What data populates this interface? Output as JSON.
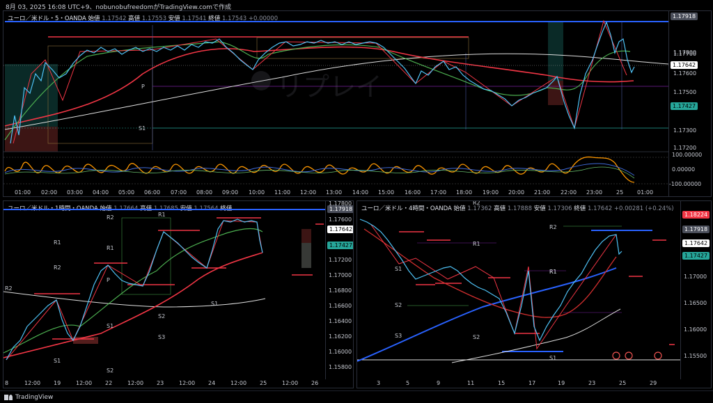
{
  "header": {
    "text": "8月 03, 2025 16:08 UTC+9、nobunobufreedomがTradingView.comで作成"
  },
  "footer": {
    "brand": "TradingView"
  },
  "watermark": "リプレイ",
  "colors": {
    "blue": "#2962ff",
    "red": "#f23645",
    "green": "#4caf50",
    "orange": "#ff9800",
    "white": "#e0e0e0",
    "cyan": "#26c6da",
    "bg": "#000000"
  },
  "top_chart": {
    "title": "ユーロ／米ドル・5・OANDA",
    "ohlc_prefix": "始値",
    "high_label": "高値",
    "low_label": "安値",
    "close_label": "終値",
    "price_ticks": [
      "1.17800",
      "1.17700",
      "1.17600",
      "1.17500",
      "1.17300",
      "1.17200"
    ],
    "price_tags": [
      {
        "value": "1.17918",
        "kind": "grey"
      },
      {
        "value": "1.17642",
        "kind": "white"
      },
      {
        "value": "1.17427",
        "kind": "cyan"
      }
    ],
    "pivot_labels": [
      "P",
      "S1"
    ],
    "osc_ticks": [
      "100.00000",
      "0.00000",
      "-100.00000"
    ],
    "time_ticks": [
      "01:00",
      "02:00",
      "03:00",
      "04:00",
      "05:00",
      "06:00",
      "07:00",
      "08:00",
      "09:00",
      "10:00",
      "11:00",
      "12:00",
      "13:00",
      "14:00",
      "15:00",
      "16:00",
      "17:00",
      "18:00",
      "19:00",
      "20:00",
      "21:00",
      "22:00",
      "23:00",
      "25",
      "01:00"
    ]
  },
  "left_chart": {
    "title": "ユーロ／米ドル・1時間・OANDA",
    "ohlc_prefix": "始値",
    "high_label": "高値",
    "low_label": "安値",
    "close_label": "終値",
    "price_ticks": [
      "1.17800",
      "1.17600",
      "1.17400",
      "1.17200",
      "1.17000",
      "1.16800",
      "1.16600",
      "1.16400",
      "1.16200",
      "1.16000",
      "1.15800"
    ],
    "price_tags": [
      {
        "value": "1.17918",
        "kind": "grey"
      },
      {
        "value": "1.17642",
        "kind": "white"
      },
      {
        "value": "1.17427",
        "kind": "cyan"
      }
    ],
    "pivot_labels": [
      "R2",
      "R1",
      "R2",
      "R1",
      "P",
      "S1",
      "S2",
      "S3",
      "S1",
      "S2",
      "R1",
      "R2",
      "S1"
    ],
    "time_ticks": [
      "8",
      "12:00",
      "19",
      "12:00",
      "22",
      "12:00",
      "23",
      "12:00",
      "24",
      "12:00",
      "25",
      "12:00",
      "26"
    ]
  },
  "right_chart": {
    "title": "ユーロ／米ドル・4時間・OANDA",
    "ohlc_prefix": "始値",
    "high_label": "高値",
    "low_label": "安値",
    "close_label": "終値",
    "close_value": "1.17642",
    "change": "+0.00281 (+0.24%)",
    "price_ticks": [
      "1.17500",
      "1.17000",
      "1.16500",
      "1.16000",
      "1.15500"
    ],
    "price_tags": [
      {
        "value": "1.18224",
        "kind": "red"
      },
      {
        "value": "1.17918",
        "kind": "grey"
      },
      {
        "value": "1.17642",
        "kind": "white"
      },
      {
        "value": "1.17427",
        "kind": "cyan"
      }
    ],
    "pivot_labels": [
      "R2",
      "R1",
      "R1",
      "R2",
      "S1",
      "S2",
      "S3",
      "S2",
      "S1",
      "R1"
    ],
    "time_ticks": [
      "3",
      "5",
      "9",
      "11",
      "15",
      "17",
      "19",
      "23",
      "25",
      "29"
    ]
  }
}
